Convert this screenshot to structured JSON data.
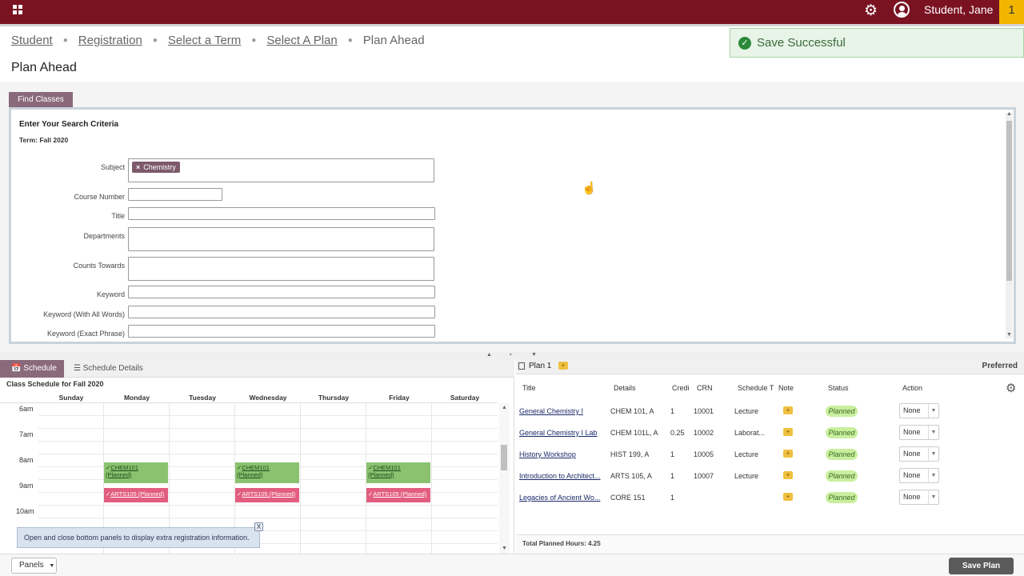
{
  "topbar": {
    "user_name": "Student, Jane",
    "notification_count": "1"
  },
  "breadcrumb": {
    "items": [
      "Student",
      "Registration",
      "Select a Term",
      "Select A Plan"
    ],
    "current": "Plan Ahead"
  },
  "page_title": "Plan Ahead",
  "save_message": "Save Successful",
  "find_tab_label": "Find Classes",
  "search": {
    "heading": "Enter Your Search Criteria",
    "term": "Term: Fall 2020",
    "subject_label": "Subject",
    "subject_chip": "Chemistry",
    "course_number_label": "Course Number",
    "title_label": "Title",
    "departments_label": "Departments",
    "counts_towards_label": "Counts Towards",
    "keyword_label": "Keyword",
    "keyword_all_label": "Keyword (With All Words)",
    "keyword_exact_label": "Keyword (Exact Phrase)"
  },
  "schedule": {
    "tab_schedule": "Schedule",
    "tab_details": "Schedule Details",
    "title": "Class Schedule for Fall 2020",
    "days": [
      "Sunday",
      "Monday",
      "Tuesday",
      "Wednesday",
      "Thursday",
      "Friday",
      "Saturday"
    ],
    "hours": [
      "6am",
      "7am",
      "8am",
      "9am",
      "10am"
    ],
    "chem_event": "CHEM101",
    "chem_status": "(Planned)",
    "arts_event": "ARTS105 (Planned)",
    "tip": "Open and close bottom panels to display extra registration information.",
    "tip_close": "X"
  },
  "plan": {
    "name": "Plan 1",
    "preferred": "Preferred",
    "headers": [
      "Title",
      "Details",
      "Credi",
      "CRN",
      "Schedule T",
      "Note",
      "Status",
      "Action"
    ],
    "rows": [
      {
        "title": "General Chemistry I",
        "details": "CHEM 101, A",
        "credits": "1",
        "crn": "10001",
        "schedule": "Lecture",
        "status": "Planned",
        "action": "None"
      },
      {
        "title": "General Chemistry I Lab",
        "details": "CHEM 101L, A",
        "credits": "0.25",
        "crn": "10002",
        "schedule": "Laborat...",
        "status": "Planned",
        "action": "None"
      },
      {
        "title": "History Workshop",
        "details": "HIST 199, A",
        "credits": "1",
        "crn": "10005",
        "schedule": "Lecture",
        "status": "Planned",
        "action": "None"
      },
      {
        "title": "Introduction to Architect...",
        "details": "ARTS 105, A",
        "credits": "1",
        "crn": "10007",
        "schedule": "Lecture",
        "status": "Planned",
        "action": "None"
      },
      {
        "title": "Legacies of Ancient Wo...",
        "details": "CORE 151",
        "credits": "1",
        "crn": "",
        "schedule": "",
        "status": "Planned",
        "action": "None"
      }
    ],
    "total": "Total Planned Hours: 4.25"
  },
  "footer": {
    "panels": "Panels",
    "save_plan": "Save Plan"
  },
  "icons": {
    "grid": "grid-icon",
    "gear": "gear-icon",
    "user": "user-icon",
    "check": "check-icon",
    "calendar": "calendar-icon",
    "list": "list-icon",
    "note": "add-note-icon"
  },
  "colors": {
    "brand": "#7a1222",
    "tab": "#8a6a7a",
    "notif": "#f2b600",
    "planned_green": "#8bc26f",
    "planned_pink": "#e25d7f"
  }
}
